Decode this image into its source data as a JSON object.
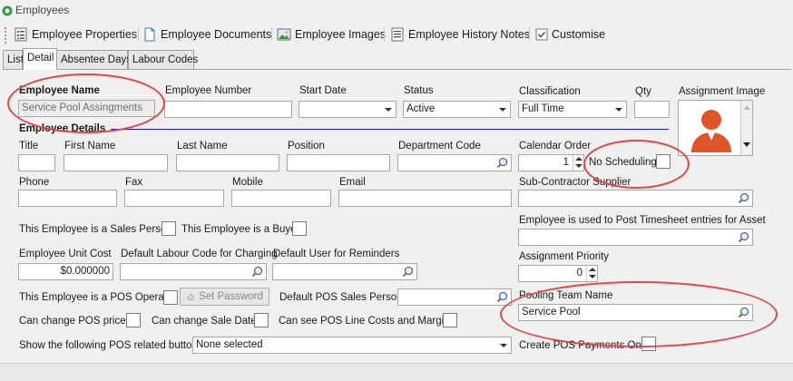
{
  "window": {
    "title": "Employees"
  },
  "toolbar": {
    "items": [
      {
        "label": "Employee Properties",
        "icon": "properties-icon"
      },
      {
        "label": "Employee Documents",
        "icon": "document-icon"
      },
      {
        "label": "Employee Images",
        "icon": "image-icon"
      },
      {
        "label": "Employee History Notes",
        "icon": "notes-icon"
      },
      {
        "label": "Customise",
        "icon": "checkbox-icon"
      }
    ]
  },
  "tabs": [
    "List",
    "Detail",
    "Absentee Days",
    "Labour Codes"
  ],
  "active_tab": "Detail",
  "form": {
    "employee_name_label": "Employee Name",
    "employee_name_value": "Service Pool Assingments",
    "employee_number_label": "Employee Number",
    "employee_number_value": "",
    "start_date_label": "Start Date",
    "start_date_value": "",
    "status_label": "Status",
    "status_value": "Active",
    "classification_label": "Classification",
    "classification_value": "Full Time",
    "qty_label": "Qty",
    "qty_value": "",
    "assignment_image_label": "Assignment Image",
    "employee_details_header": "Employee Details",
    "title_label": "Title",
    "first_name_label": "First Name",
    "last_name_label": "Last Name",
    "position_label": "Position",
    "department_code_label": "Department Code",
    "calendar_order_label": "Calendar Order",
    "calendar_order_value": "1",
    "no_scheduling_label": "No Scheduling",
    "phone_label": "Phone",
    "fax_label": "Fax",
    "mobile_label": "Mobile",
    "email_label": "Email",
    "subcontractor_label": "Sub-Contractor Supplier",
    "sales_person_label": "This Employee is a Sales Person",
    "buyer_label": "This Employee is a Buyer",
    "asset_timesheet_label": "Employee is used to Post Timesheet entries for Asset",
    "unit_cost_label": "Employee Unit Cost",
    "unit_cost_value": "$0.000000",
    "default_labour_label": "Default Labour Code for Charging",
    "default_user_label": "Default User for Reminders",
    "assignment_priority_label": "Assignment Priority",
    "assignment_priority_value": "0",
    "pos_operator_label": "This Employee is a POS Operator",
    "set_password_label": "Set Password",
    "default_pos_sales_label": "Default POS Sales Person",
    "pooling_team_label": "Pooling Team Name",
    "pooling_team_value": "Service Pool",
    "change_pos_prices_label": "Can change POS prices",
    "change_sale_date_label": "Can change Sale Date",
    "see_pos_line_costs_label": "Can see POS Line Costs and Margins",
    "pos_buttons_label": "Show the following POS related buttons",
    "pos_buttons_value": "None selected",
    "create_pos_payments_label": "Create POS Payments Only"
  },
  "colors": {
    "accent_line": "#1a1acc",
    "annotation": "#e04848",
    "avatar": "#e0542a"
  }
}
